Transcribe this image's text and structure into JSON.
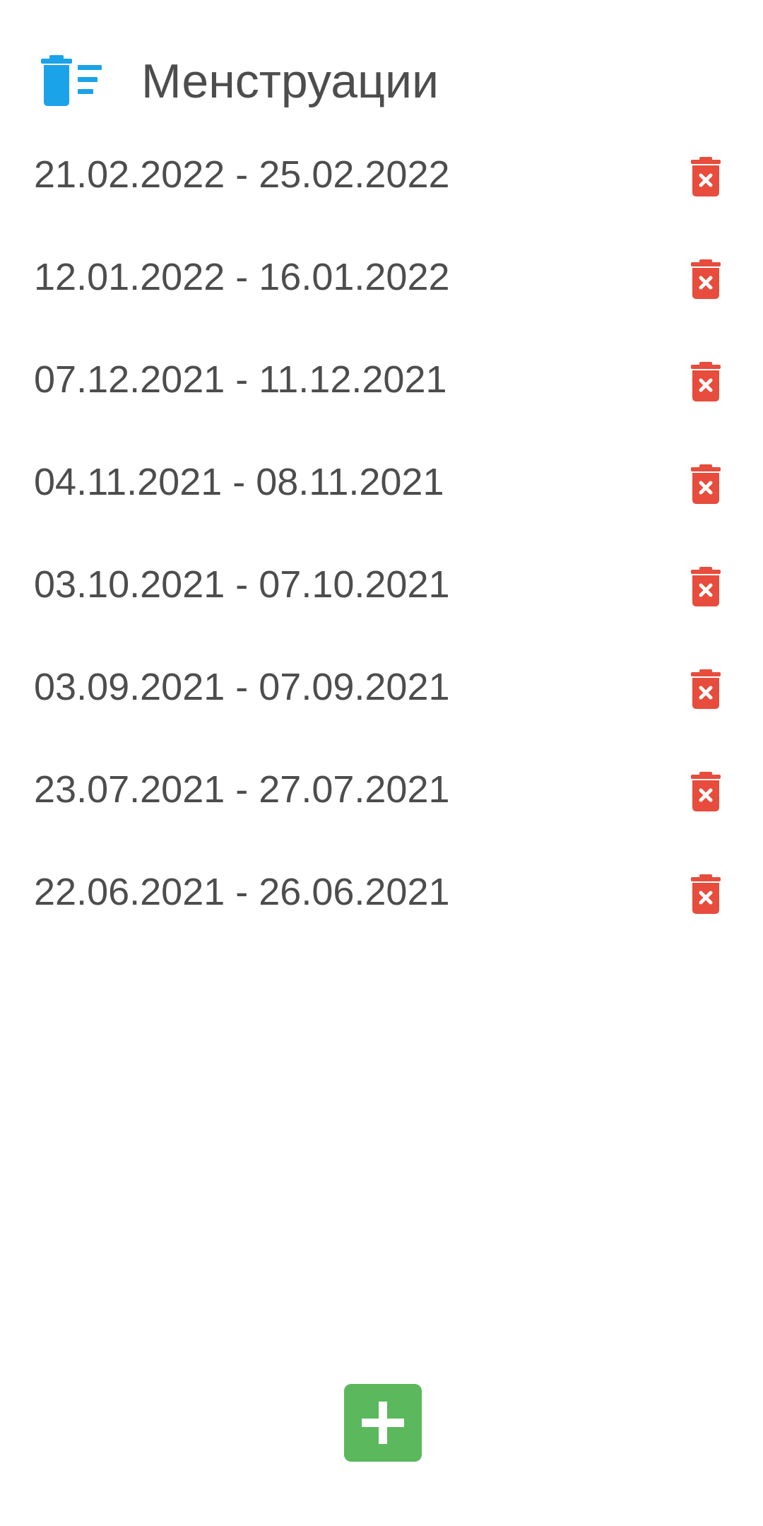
{
  "header": {
    "title": "Менструации",
    "icon": "delete-list-icon",
    "icon_color": "#1aa3e8"
  },
  "periods": [
    {
      "label": "21.02.2022 - 25.02.2022"
    },
    {
      "label": "12.01.2022 - 16.01.2022"
    },
    {
      "label": "07.12.2021 - 11.12.2021"
    },
    {
      "label": "04.11.2021 - 08.11.2021"
    },
    {
      "label": "03.10.2021 - 07.10.2021"
    },
    {
      "label": "03.09.2021 - 07.09.2021"
    },
    {
      "label": "23.07.2021 - 27.07.2021"
    },
    {
      "label": "22.06.2021 - 26.06.2021"
    }
  ],
  "row_action": {
    "icon": "trash-delete-icon",
    "color": "#e74c3c"
  },
  "fab": {
    "icon": "plus-icon",
    "color": "#5cb85c"
  }
}
